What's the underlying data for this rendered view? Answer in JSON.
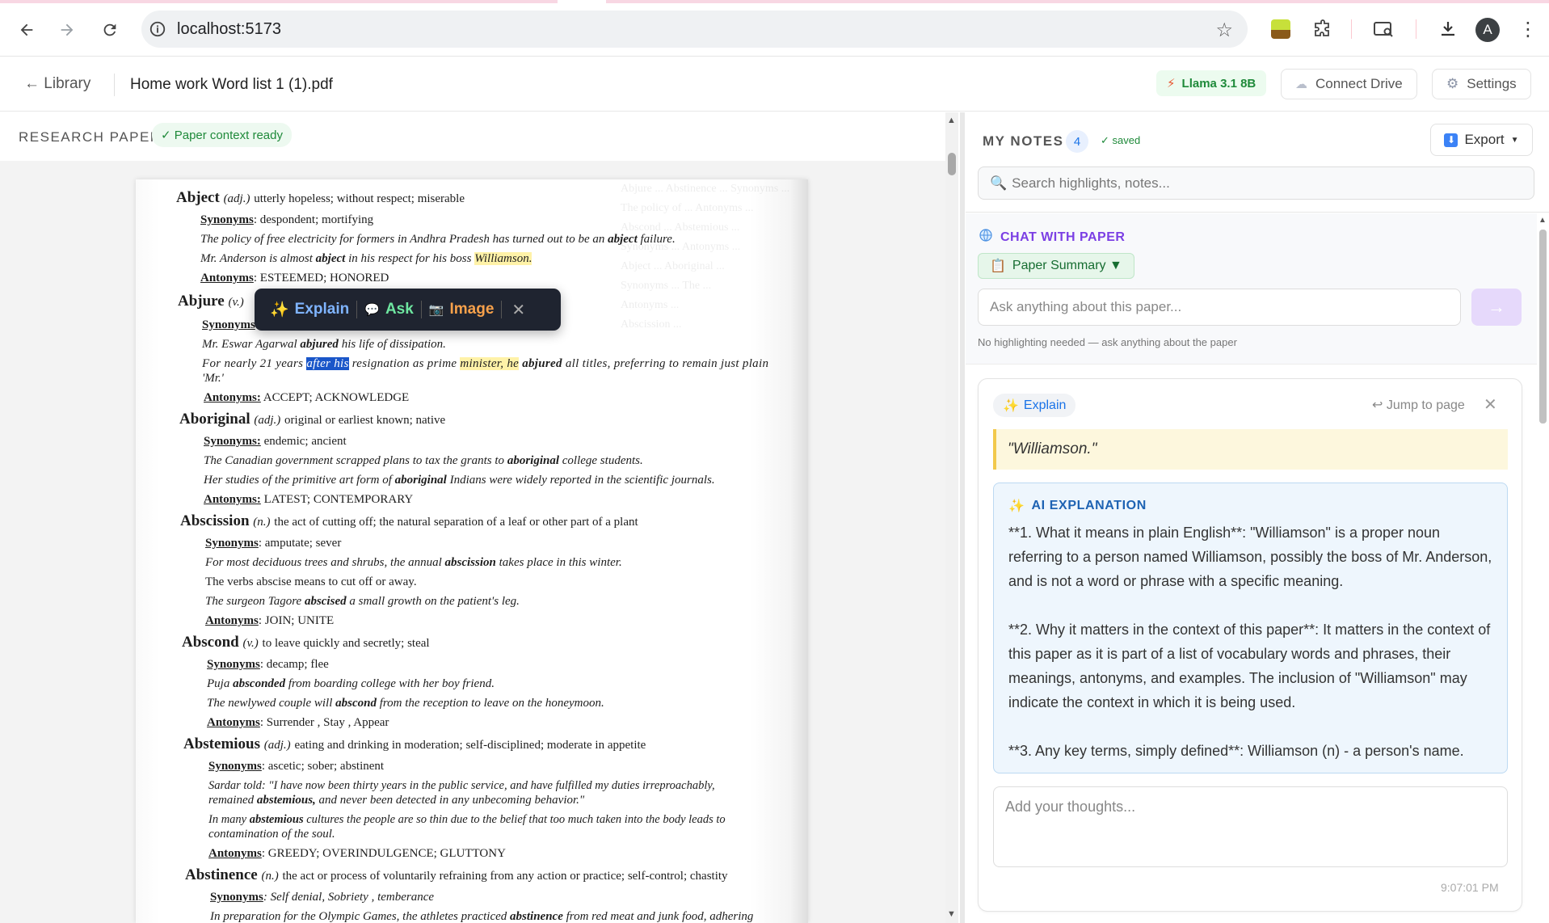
{
  "browser": {
    "url": "localhost:5173",
    "profile_initial": "A"
  },
  "app": {
    "back_label": "← Library",
    "document_title": "Home work Word list 1 (1).pdf",
    "model_label": "Llama 3.1 8B",
    "connect_drive_label": "Connect Drive",
    "settings_label": "Settings"
  },
  "paper_pane": {
    "title": "RESEARCH PAPER",
    "context_badge": "✓ Paper context ready"
  },
  "toolbar": {
    "explain": "Explain",
    "ask": "Ask",
    "image": "Image"
  },
  "notes": {
    "title": "MY NOTES",
    "count": "4",
    "saved": "✓ saved",
    "export_label": "Export",
    "search_placeholder": "Search highlights, notes..."
  },
  "chat": {
    "title": "CHAT WITH PAPER",
    "summary_pill": "Paper Summary ▼",
    "input_placeholder": "Ask anything about this paper...",
    "hint": "No highlighting needed — ask anything about the paper"
  },
  "note_card": {
    "tag": "Explain",
    "jump": "Jump to page",
    "quote": "\"Williamson.\"",
    "ai_title": "AI EXPLANATION",
    "ai_paragraphs": [
      "**1. What it means in plain English**: \"Williamson\" is a proper noun referring to a person named Williamson, possibly the boss of Mr. Anderson, and is not a word or phrase with a specific meaning.",
      "**2. Why it matters in the context of this paper**: It matters in the context of this paper as it is part of a list of vocabulary words and phrases, their meanings, antonyms, and examples. The inclusion of \"Williamson\" may indicate the context in which it is being used.",
      "**3. Any key terms, simply defined**: Williamson (n) - a person's name."
    ],
    "thoughts_placeholder": "Add your thoughts...",
    "timestamp": "9:07:01 PM"
  },
  "page_text": {
    "abject_hw": "Abject",
    "abject_pos": "(adj.)",
    "abject_def": "utterly hopeless; without respect; miserable",
    "abject_syn_label": "Synonyms",
    "abject_syn": ": despondent; mortifying",
    "abject_ex1": "The policy of free electricity for formers in Andhra Pradesh has turned out to be an",
    "abject_ex1_b": "abject",
    "abject_ex1_c": "failure.",
    "abject_ex2_a": "Mr. Anderson is almost",
    "abject_ex2_b": "abject",
    "abject_ex2_c": "in his respect for his boss",
    "abject_ex2_d": "Williamson.",
    "abject_ant_label": "Antonyms",
    "abject_ant": ": ESTEEMED; HONORED",
    "abjure_hw": "Abjure",
    "abjure_pos": "(v.)",
    "abjure_syn_label": "Synonyms",
    "abjure_ex1_a": "Mr. Eswar Agarwal",
    "abjure_ex1_b": "abjured",
    "abjure_ex1_c": "his life of dissipation.",
    "abjure_ex2_a": "For nearly 21 years",
    "abjure_ex2_sel": "after his",
    "abjure_ex2_b": "resignation as prime",
    "abjure_ex2_hl": "minister, he",
    "abjure_ex2_c": "abjured",
    "abjure_ex2_d": "all titles, preferring to remain just plain",
    "abjure_ex2_e": "'Mr.'",
    "abjure_ant_label": "Antonyms:",
    "abjure_ant": "ACCEPT; ACKNOWLEDGE",
    "abor_hw": "Aboriginal",
    "abor_pos": "(adj.)",
    "abor_def": "original or earliest known; native",
    "abor_syn_label": "Synonyms:",
    "abor_syn": "endemic; ancient",
    "abor_ex1_a": "The Canadian government scrapped plans to tax the grants to",
    "abor_ex1_b": "aboriginal",
    "abor_ex1_c": "college students.",
    "abor_ex2_a": "Her studies of the primitive art form of",
    "abor_ex2_b": "aboriginal",
    "abor_ex2_c": "Indians were widely reported in the scientific journals.",
    "abor_ant_label": "Antonyms:",
    "abor_ant": "LATEST; CONTEMPORARY",
    "absc_hw": "Abscission",
    "absc_pos": "(n.)",
    "absc_def": "the act of cutting off; the natural separation of a leaf or other part of a plant",
    "absc_syn_label": "Synonyms",
    "absc_syn": ": amputate; sever",
    "absc_ex1_a": "For most deciduous trees and shrubs, the annual",
    "absc_ex1_b": "abscission",
    "absc_ex1_c": "takes place in this winter.",
    "absc_ex2": "The verbs abscise means to cut off or away.",
    "absc_ex3_a": "The surgeon Tagore",
    "absc_ex3_b": "abscised",
    "absc_ex3_c": "a small growth on the patient's leg.",
    "absc_ant_label": "Antonyms",
    "absc_ant": ": JOIN; UNITE",
    "absd_hw": "Abscond",
    "absd_pos": "(v.)",
    "absd_def": "to leave quickly and secretly; steal",
    "absd_syn_label": "Synonyms",
    "absd_syn": ": decamp; flee",
    "absd_ex1_a": "Puja",
    "absd_ex1_b": "absconded",
    "absd_ex1_c": "from boarding college with her boy friend.",
    "absd_ex2_a": "The newlywed couple will",
    "absd_ex2_b": "abscond",
    "absd_ex2_c": "from the reception to leave on the honeymoon.",
    "absd_ant_label": "Antonyms",
    "absd_ant": ": Surrender , Stay , Appear",
    "abstm_hw": "Abstemious",
    "abstm_pos": "(adj.)",
    "abstm_def": "eating and drinking in moderation; self-disciplined; moderate in appetite",
    "abstm_syn_label": "Synonyms",
    "abstm_syn": ": ascetic; sober; abstinent",
    "abstm_ex1": "Sardar told: \"I have now been thirty years in the public service, and have fulfilled my duties irreproachably,",
    "abstm_ex1b_a": "remained",
    "abstm_ex1b_b": "abstemious,",
    "abstm_ex1b_c": "and never been detected in any unbecoming behavior.\"",
    "abstm_ex2_a": "In many",
    "abstm_ex2_b": "abstemious",
    "abstm_ex2_c": "cultures the people are so thin due to the belief that too much taken into the body leads to",
    "abstm_ex2d": "contamination of the soul.",
    "abstm_ant_label": "Antonyms",
    "abstm_ant": ": GREEDY; OVERINDULGENCE; GLUTTONY",
    "abstn_hw": "Abstinence",
    "abstn_pos": "(n.)",
    "abstn_def": "the act or process of voluntarily refraining from any action or practice; self-control; chastity",
    "abstn_syn_label": "Synonyms",
    "abstn_syn": ": Self denial, Sobriety , temberance",
    "abstn_ex1_a": "In preparation for the Olympic Games, the athletes practiced",
    "abstn_ex1_b": "abstinence",
    "abstn_ex1_c": "from red meat and junk food, adhering"
  }
}
